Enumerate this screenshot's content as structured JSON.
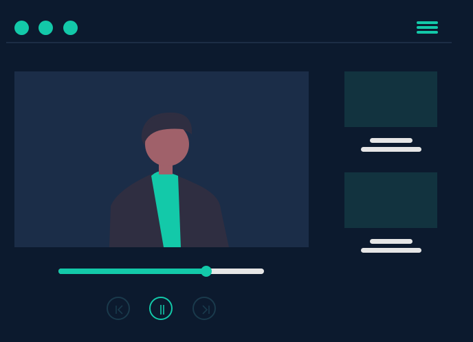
{
  "colors": {
    "background": "#0c1a2e",
    "accent": "#13c9a9",
    "video_bg": "#1b2d48",
    "thumbnail": "#12333f",
    "text_line": "#e6e6e6",
    "divider": "#1c2d45",
    "dim_control": "#1a3a4c",
    "jacket": "#2f2e41",
    "skin": "#a0616a",
    "hair": "#2f2e41"
  },
  "window": {
    "dots": [
      {
        "name": "window-dot-1"
      },
      {
        "name": "window-dot-2"
      },
      {
        "name": "window-dot-3"
      }
    ],
    "menu_icon": "hamburger-icon"
  },
  "playlist": [
    {
      "name": "playlist-item-1"
    },
    {
      "name": "playlist-item-2"
    }
  ],
  "player": {
    "progress_fraction": 0.72,
    "controls": [
      {
        "icon": "skip-previous-icon",
        "active": false
      },
      {
        "icon": "pause-icon",
        "active": true
      },
      {
        "icon": "skip-next-icon",
        "active": false
      }
    ]
  }
}
